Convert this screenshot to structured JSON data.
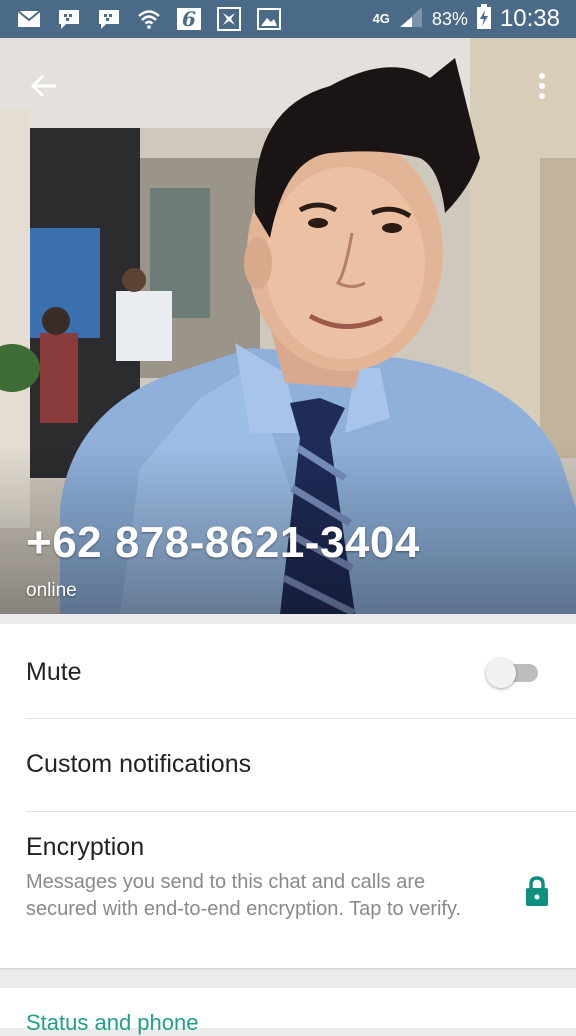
{
  "status_bar": {
    "network": "4G",
    "battery": "83%",
    "time": "10:38",
    "icons": [
      "mail-icon",
      "bbm-icon",
      "bbm-icon",
      "wifi-icon",
      "app-6-icon",
      "blackberry-icon",
      "image-icon"
    ]
  },
  "header": {
    "phone_number": "+62 878-8621-3404",
    "status": "online"
  },
  "settings": {
    "mute_label": "Mute",
    "mute_enabled": false,
    "custom_notifications_label": "Custom notifications",
    "encryption_title": "Encryption",
    "encryption_description": "Messages you send to this chat and calls are secured with end-to-end encryption. Tap to verify."
  },
  "next_section": {
    "title": "Status and phone"
  },
  "colors": {
    "status_bar": "#4a6a87",
    "accent": "#20a08a",
    "lock": "#0f8f7e"
  }
}
